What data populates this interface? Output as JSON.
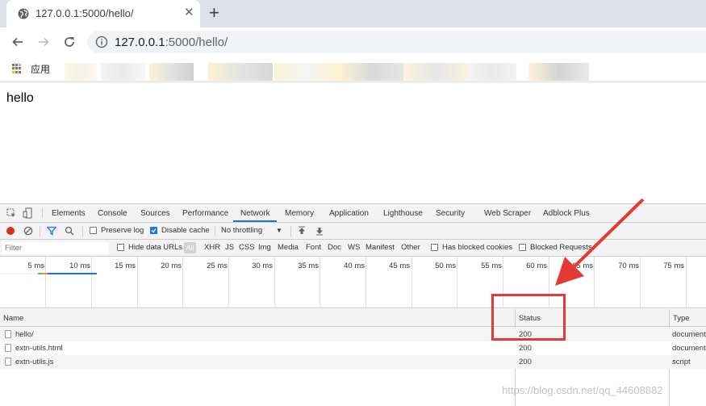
{
  "browser": {
    "tab_title": "127.0.0.1:5000/hello/",
    "url_host": "127.0.0.1",
    "url_rest": ":5000/hello/",
    "bookmark_apps": "应用"
  },
  "page": {
    "body_text": "hello"
  },
  "devtools": {
    "tabs": [
      "Elements",
      "Console",
      "Sources",
      "Performance",
      "Network",
      "Memory",
      "Application",
      "Lighthouse",
      "Security",
      "Web Scraper",
      "Adblock Plus"
    ],
    "active_tab": "Network",
    "controls": {
      "preserve_log": "Preserve log",
      "disable_cache": "Disable cache",
      "throttling": "No throttling"
    },
    "filter": {
      "placeholder": "Filter",
      "hide_data_urls": "Hide data URLs",
      "all": "All",
      "types": [
        "XHR",
        "JS",
        "CSS",
        "Img",
        "Media",
        "Font",
        "Doc",
        "WS",
        "Manifest",
        "Other"
      ],
      "has_blocked_cookies": "Has blocked cookies",
      "blocked_requests": "Blocked Requests"
    },
    "timeline_ticks": [
      "5 ms",
      "10 ms",
      "15 ms",
      "20 ms",
      "25 ms",
      "30 ms",
      "35 ms",
      "40 ms",
      "45 ms",
      "50 ms",
      "55 ms",
      "60 ms",
      "65 ms",
      "70 ms",
      "75 ms"
    ],
    "columns": {
      "name": "Name",
      "status": "Status",
      "type": "Type"
    },
    "rows": [
      {
        "name": "hello/",
        "status": "200",
        "type": "document"
      },
      {
        "name": "extn-utils.html",
        "status": "200",
        "type": "document"
      },
      {
        "name": "extn-utils.js",
        "status": "200",
        "type": "script"
      }
    ]
  },
  "watermark": "https://blog.csdn.net/qq_44608882",
  "colors": {
    "highlight": "#e53935",
    "active_tab": "#1a73e8",
    "record": "#d93025"
  }
}
